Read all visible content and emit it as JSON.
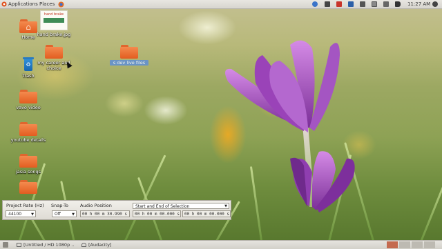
{
  "top_panel": {
    "applications_label": "Applications",
    "places_label": "Places",
    "clock": "11:27 AM"
  },
  "desktop_icons": [
    {
      "name": "Home"
    },
    {
      "name": "hand brake.jpg"
    },
    {
      "name": "my career and choice"
    },
    {
      "name": "s dev live files"
    },
    {
      "name": "Trash"
    },
    {
      "name": "vavo video"
    },
    {
      "name": "youtube details"
    },
    {
      "name": "jasia songs"
    }
  ],
  "thumbnail_text": "hand brake",
  "audacity": {
    "project_rate_label": "Project Rate (Hz)",
    "project_rate_value": "44100",
    "snap_to_label": "Snap-To",
    "snap_to_value": "Off",
    "audio_position_label": "Audio Position",
    "audio_position_value": "00 h 00 m 30.990 s",
    "selection_mode": "Start and End of Selection",
    "selection_start": "00 h 00 m 00.000 s",
    "selection_end": "00 h 00 m 00.000 s"
  },
  "taskbar": {
    "task1": "[Untitled / HD 1080p ...",
    "task2": "[Audacity]"
  },
  "colors": {
    "folder_orange": "#e35d20",
    "selection_blue": "#5f8fd6",
    "workspace_active": "#c46a4f"
  }
}
